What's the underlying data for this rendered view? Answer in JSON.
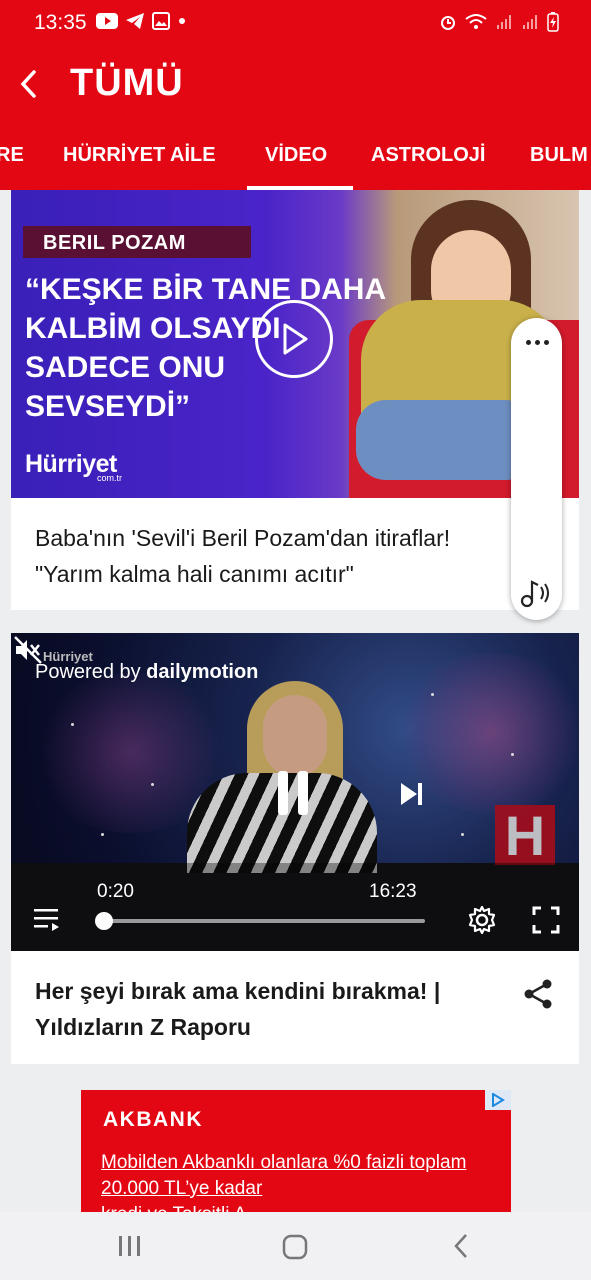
{
  "status_bar": {
    "time": "13:35",
    "icons_left": [
      "youtube-icon",
      "telegram-icon",
      "gallery-icon",
      "dot-icon"
    ],
    "icons_right": [
      "alarm-icon",
      "wifi-icon",
      "signal-icon",
      "signal-icon",
      "battery-charging-icon"
    ]
  },
  "app_bar": {
    "title": "TÜMÜ",
    "back_icon": "chevron-left-icon"
  },
  "tabs": [
    {
      "label": "RE"
    },
    {
      "label": "HÜRRİYET AİLE"
    },
    {
      "label": "VİDEO",
      "active": true
    },
    {
      "label": "ASTROLOJİ"
    },
    {
      "label": "BULM"
    }
  ],
  "card1": {
    "thumbnail": {
      "name": "BERIL POZAM",
      "quote": "“KEŞKE BİR TANE DAHA KALBİM OLSAYDI SADECE ONU SEVSEYDİ”",
      "brand": "Hürriyet",
      "brand_sub": "com.tr"
    },
    "title": "Baba'nın 'Sevil'i Beril Pozam'dan itiraflar! \"Yarım kalma hali canımı acıtır\""
  },
  "side_panel": {
    "more_icon": "more-horizontal-icon",
    "audio_icon": "audio-note-icon"
  },
  "card2": {
    "player": {
      "watermark": "Hürriyet",
      "powered_by_prefix": "Powered by ",
      "powered_by_brand": "dailymotion",
      "current_time": "0:20",
      "duration": "16:23",
      "progress": 0.02,
      "logo_letter": "H"
    },
    "title": "Her şeyi bırak ama kendini bırakma! | Yıldızların Z Raporu"
  },
  "ad": {
    "brand": "AKBANK",
    "text": "Mobilden Akbanklı olanlara %0 faizli toplam 20.000 TL’ye kadar",
    "text_cut": "kredi ve Taksitli A..."
  },
  "nav_bar": {
    "icons": [
      "recents-icon",
      "home-icon",
      "back-icon"
    ]
  },
  "colors": {
    "brand_red": "#e30613",
    "background": "#eceef0"
  }
}
